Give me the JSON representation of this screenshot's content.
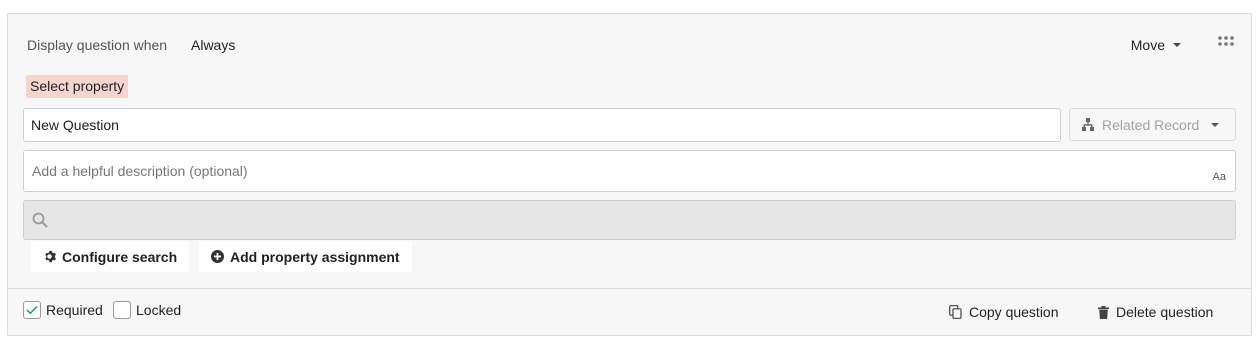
{
  "header": {
    "display_label": "Display question when",
    "display_value": "Always",
    "move_label": "Move",
    "drag_icon": "drag-handle-icon"
  },
  "property": {
    "select_label": "Select property",
    "highlight_color": "#f6d4d0"
  },
  "question": {
    "value": "New Question",
    "placeholder": ""
  },
  "related_record": {
    "label": "Related Record",
    "icon": "hierarchy-icon"
  },
  "description": {
    "placeholder": "Add a helpful description (optional)",
    "value": "",
    "format_label": "Aa"
  },
  "search": {
    "placeholder": "",
    "icon": "search-icon"
  },
  "actions": {
    "configure_search": "Configure search",
    "add_property_assignment": "Add property assignment"
  },
  "footer": {
    "required_label": "Required",
    "required_checked": true,
    "locked_label": "Locked",
    "locked_checked": false,
    "copy_label": "Copy question",
    "delete_label": "Delete question",
    "check_color": "#2a9d6f"
  }
}
